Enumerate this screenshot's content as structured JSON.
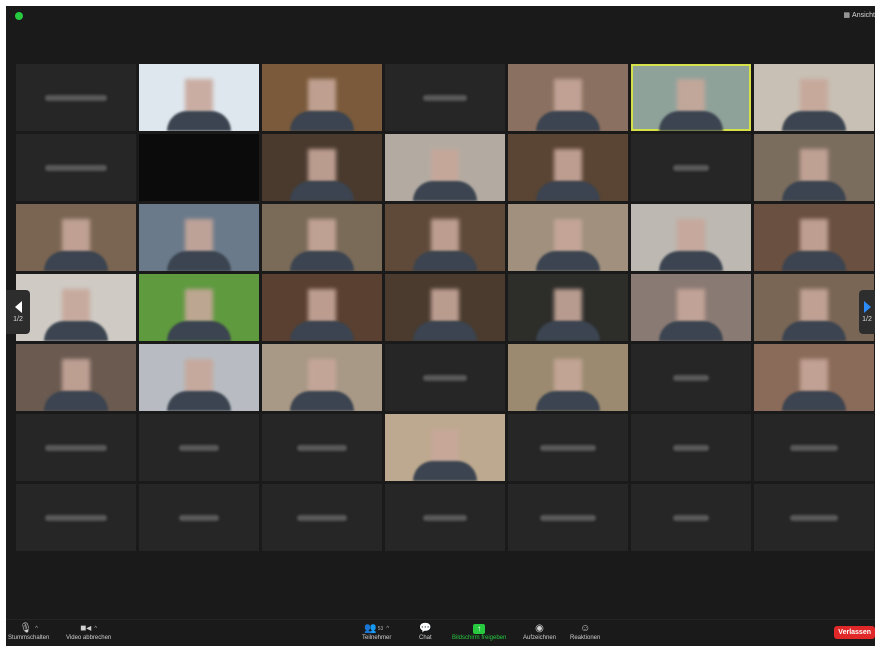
{
  "topbar": {
    "view_label": "Ansicht",
    "icons": [
      "shield-icon",
      "grid-view-icon"
    ],
    "colors": {
      "shield": "#27c93f"
    }
  },
  "pagination": {
    "left_page": "1/2",
    "right_page": "1/2",
    "colors": {
      "left_arrow": "#ffffff",
      "right_arrow": "#2d8cff"
    }
  },
  "gallery": {
    "layout": "7 columns x 7 rows",
    "active_speaker_color": "#d6e14a",
    "tiles": [
      {
        "type": "name"
      },
      {
        "type": "video",
        "bg": "#dfe7ee"
      },
      {
        "type": "video",
        "bg": "#7a5a3a"
      },
      {
        "type": "name"
      },
      {
        "type": "video",
        "bg": "#8a7060"
      },
      {
        "type": "video",
        "bg": "#8fa29a",
        "active": true
      },
      {
        "type": "video",
        "bg": "#c8c0b4"
      },
      {
        "type": "name"
      },
      {
        "type": "black"
      },
      {
        "type": "video",
        "bg": "#4a3a2e"
      },
      {
        "type": "video",
        "bg": "#b3aba2"
      },
      {
        "type": "video",
        "bg": "#5a4433"
      },
      {
        "type": "name"
      },
      {
        "type": "video",
        "bg": "#7b6d5e"
      },
      {
        "type": "video",
        "bg": "#7a6552"
      },
      {
        "type": "video",
        "bg": "#6a7a8a"
      },
      {
        "type": "video",
        "bg": "#7a6a58"
      },
      {
        "type": "video",
        "bg": "#5f4a3a"
      },
      {
        "type": "video",
        "bg": "#a0907d"
      },
      {
        "type": "video",
        "bg": "#bdb8b2"
      },
      {
        "type": "video",
        "bg": "#6a5040"
      },
      {
        "type": "video",
        "bg": "#cfcac4"
      },
      {
        "type": "video",
        "bg": "#5f9a3f"
      },
      {
        "type": "video",
        "bg": "#5a4030"
      },
      {
        "type": "video",
        "bg": "#4a3b2e"
      },
      {
        "type": "video",
        "bg": "#2d2d2a"
      },
      {
        "type": "video",
        "bg": "#8a7a74"
      },
      {
        "type": "video",
        "bg": "#7a6655"
      },
      {
        "type": "video",
        "bg": "#6a5a50"
      },
      {
        "type": "video",
        "bg": "#b8bcc2"
      },
      {
        "type": "video",
        "bg": "#a89886"
      },
      {
        "type": "name"
      },
      {
        "type": "video",
        "bg": "#9b8a70"
      },
      {
        "type": "name"
      },
      {
        "type": "video",
        "bg": "#8a6a58"
      },
      {
        "type": "name"
      },
      {
        "type": "name"
      },
      {
        "type": "name"
      },
      {
        "type": "video",
        "bg": "#bda98f"
      },
      {
        "type": "name"
      },
      {
        "type": "name"
      },
      {
        "type": "name"
      },
      {
        "type": "name"
      },
      {
        "type": "name"
      },
      {
        "type": "name"
      },
      {
        "type": "name"
      },
      {
        "type": "name"
      },
      {
        "type": "name"
      },
      {
        "type": "name"
      }
    ]
  },
  "toolbar": {
    "mute_label": "Stummschalten",
    "video_label": "Video abbrechen",
    "participants_label": "Teilnehmer",
    "participants_count": "53",
    "chat_label": "Chat",
    "share_label": "Bildschirm freigeben",
    "record_label": "Aufzeichnen",
    "reactions_label": "Reaktionen",
    "leave_label": "Verlassen",
    "colors": {
      "share": "#27c93f",
      "leave": "#e02828"
    }
  }
}
